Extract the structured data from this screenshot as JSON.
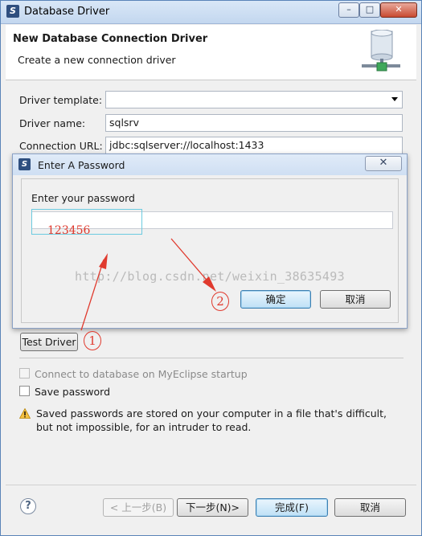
{
  "window": {
    "title": "Database Driver",
    "minimize_label": "–",
    "maximize_label": "□",
    "close_label": "✕"
  },
  "header": {
    "title": "New Database Connection Driver",
    "subtitle": "Create a new connection driver",
    "icon": "database-connector-icon"
  },
  "form": {
    "template_label": "Driver template:",
    "template_value": "",
    "name_label": "Driver name:",
    "name_value": "sqlsrv",
    "url_label": "Connection URL:",
    "url_value": "jdbc:sqlserver://localhost:1433"
  },
  "password_dialog": {
    "title": "Enter A Password",
    "close_label": "✕",
    "prompt": "Enter your password",
    "typed_text": "123456",
    "ok_label": "确定",
    "cancel_label": "取消"
  },
  "test_driver_label": "Test Driver",
  "connect_startup_label": "Connect to database on MyEclipse startup",
  "save_password_label": "Save password",
  "warning_text": "Saved passwords are stored on your computer in a file that's difficult, but not impossible, for an intruder to read.",
  "footer": {
    "help_label": "?",
    "back_label": "< 上一步(B)",
    "next_label": "下一步(N)>",
    "finish_label": "完成(F)",
    "cancel_label": "取消"
  },
  "watermark": "http://blog.csdn.net/weixin_38635493",
  "annotations": {
    "step1": "1",
    "step2": "2"
  },
  "colors": {
    "annotation": "#e03a2e",
    "highlight": "#6ccbe0",
    "title_bar": "#c3d7ef"
  }
}
